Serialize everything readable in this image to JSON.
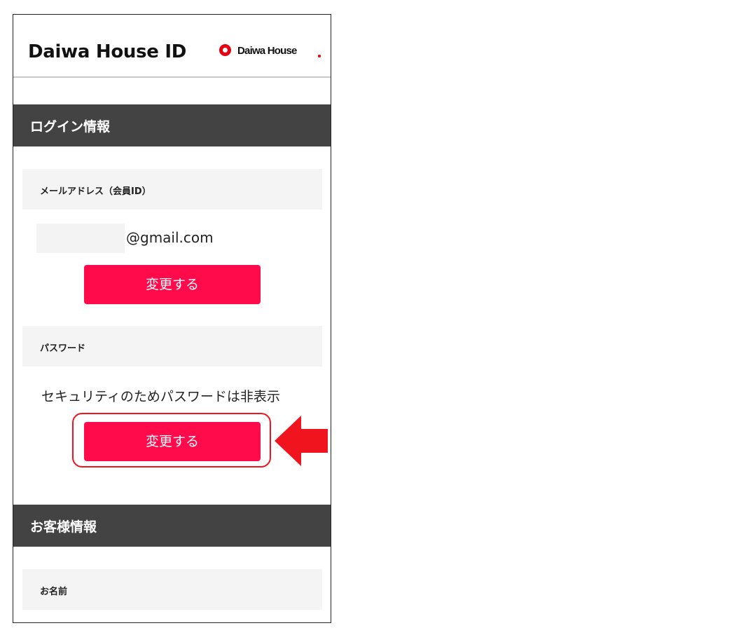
{
  "header": {
    "app_title": "Daiwa House ID",
    "brand_text": "Daiwa House"
  },
  "login_section": {
    "title": "ログイン情報",
    "email_label": "メールアドレス（会員ID）",
    "email_value": "@gmail.com",
    "email_change_button": "変更する",
    "password_label": "パスワード",
    "password_note": "セキュリティのためパスワードは非表示",
    "password_change_button": "変更する"
  },
  "customer_section": {
    "title": "お客様情報",
    "name_label": "お名前"
  },
  "colors": {
    "accent": "#ff0a4b",
    "section_bar": "#434343",
    "label_bg": "#f4f4f4",
    "annotation_red": "#f0141e",
    "brand_red": "#e60012"
  },
  "icons": {
    "brand_logo": "daiwa-house-logo-icon",
    "annotation_arrow": "left-arrow-icon"
  }
}
